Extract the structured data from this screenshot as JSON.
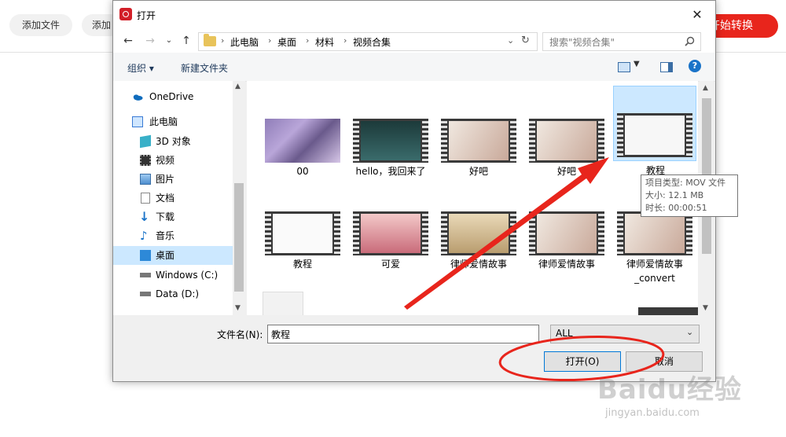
{
  "app": {
    "add_file": "添加文件",
    "add_folder": "添加",
    "start": "开始转换"
  },
  "dialog": {
    "title": "打开",
    "address": {
      "crumbs": [
        "此电脑",
        "桌面",
        "材料",
        "视频合集"
      ]
    },
    "search_placeholder": "搜索\"视频合集\"",
    "toolbar": {
      "organize": "组织 ▾",
      "new_folder": "新建文件夹"
    },
    "nav_items": [
      {
        "label": "OneDrive",
        "icon": "onedrive-icon"
      },
      {
        "label": "此电脑",
        "icon": "this-pc-icon"
      },
      {
        "label": "3D 对象",
        "icon": "3d-objects-icon"
      },
      {
        "label": "视频",
        "icon": "videos-icon"
      },
      {
        "label": "图片",
        "icon": "pictures-icon"
      },
      {
        "label": "文档",
        "icon": "documents-icon"
      },
      {
        "label": "下载",
        "icon": "downloads-icon"
      },
      {
        "label": "音乐",
        "icon": "music-icon"
      },
      {
        "label": "桌面",
        "icon": "desktop-icon"
      },
      {
        "label": "Windows (C:)",
        "icon": "drive-c-icon"
      },
      {
        "label": "Data (D:)",
        "icon": "drive-d-icon"
      }
    ],
    "files": [
      {
        "name": "00"
      },
      {
        "name": "hello，我回来了"
      },
      {
        "name": "好吧"
      },
      {
        "name": "好吧"
      },
      {
        "name": "教程"
      },
      {
        "name": "教程"
      },
      {
        "name": "可爱"
      },
      {
        "name": "律师爱情故事"
      },
      {
        "name": "律师爱情故事"
      },
      {
        "name": "律师爱情故事\n_convert"
      }
    ],
    "tooltip": {
      "type": "项目类型: MOV 文件",
      "size": "大小: 12.1 MB",
      "duration": "时长: 00:00:51"
    },
    "filename_label": "文件名(N):",
    "filename_value": "教程",
    "filetype_value": "ALL",
    "open_button": "打开(O)",
    "cancel_button": "取消"
  },
  "watermark": {
    "brand": "Baidu经验",
    "url": "jingyan.baidu.com"
  },
  "colors": {
    "accent_red": "#e8251c",
    "selection": "#cce8ff",
    "annotation_red": "#e8251c"
  }
}
